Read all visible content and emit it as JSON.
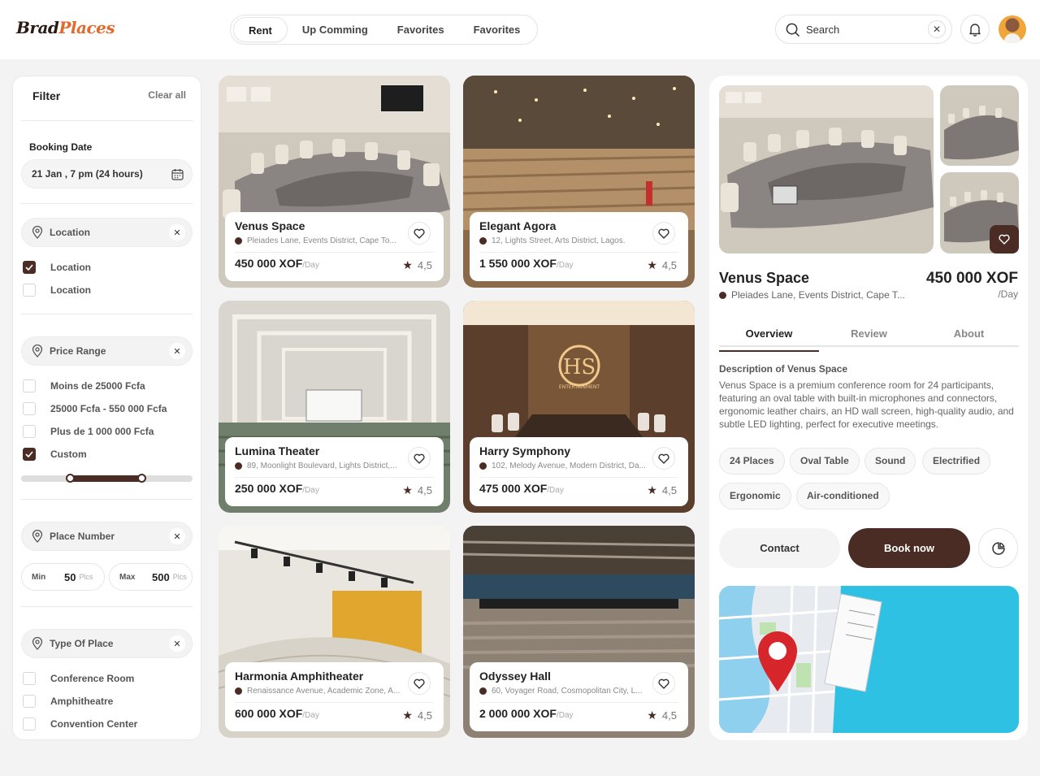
{
  "brand": {
    "part1": "Brad",
    "part2": "Places"
  },
  "nav": {
    "tabs": [
      "Rent",
      "Up Comming",
      "Favorites",
      "Favorites"
    ]
  },
  "search": {
    "placeholder": "Search"
  },
  "filter": {
    "title": "Filter",
    "clear": "Clear all",
    "booking_label": "Booking Date",
    "booking_value": "21 Jan , 7 pm  (24 hours)",
    "location": {
      "label": "Location",
      "options": [
        {
          "label": "Location",
          "checked": true
        },
        {
          "label": "Location",
          "checked": false
        }
      ]
    },
    "price": {
      "label": "Price Range",
      "options": [
        {
          "label": "Moins de 25000 Fcfa",
          "checked": false
        },
        {
          "label": "25000 Fcfa - 550 000 Fcfa",
          "checked": false
        },
        {
          "label": "Plus de 1 000 000 Fcfa",
          "checked": false
        },
        {
          "label": "Custom",
          "checked": true
        }
      ]
    },
    "place_number": {
      "label": "Place Number",
      "min_label": "Min",
      "min_value": "50",
      "max_label": "Max",
      "max_value": "500",
      "unit": "Plcs"
    },
    "type": {
      "label": "Type Of Place",
      "options": [
        {
          "label": "Conference Room",
          "checked": false
        },
        {
          "label": "Amphitheatre",
          "checked": false
        },
        {
          "label": "Convention Center",
          "checked": false
        }
      ]
    }
  },
  "cards": [
    {
      "name": "Venus Space",
      "address": "Pleiades Lane, Events District, Cape To...",
      "price": "450 000 XOF",
      "per": "/Day",
      "rating": "4,5"
    },
    {
      "name": "Elegant Agora",
      "address": "12, Lights Street, Arts District, Lagos.",
      "price": "1 550 000 XOF",
      "per": "/Day",
      "rating": "4,5"
    },
    {
      "name": "Lumina Theater",
      "address": "89, Moonlight Boulevard, Lights District,...",
      "price": "250 000 XOF",
      "per": "/Day",
      "rating": "4,5"
    },
    {
      "name": "Harry Symphony",
      "address": "102, Melody Avenue, Modern District, Da...",
      "price": "475 000 XOF",
      "per": "/Day",
      "rating": "4,5"
    },
    {
      "name": "Harmonia Amphitheater",
      "address": "Renaissance Avenue, Academic Zone, A...",
      "price": "600 000 XOF",
      "per": "/Day",
      "rating": "4,5"
    },
    {
      "name": "Odyssey Hall",
      "address": "60, Voyager Road, Cosmopolitan City, L...",
      "price": "2 000 000 XOF",
      "per": "/Day",
      "rating": "4,5"
    }
  ],
  "detail": {
    "name": "Venus Space",
    "address": "Pleiades Lane, Events District, Cape T...",
    "price": "450 000 XOF",
    "per": "/Day",
    "tabs": [
      "Overview",
      "Review",
      "About"
    ],
    "desc_title": "Description of Venus Space",
    "description": "Venus Space is a premium conference room for 24 participants, featuring an oval table with built-in microphones and connectors, ergonomic leather chairs, an HD wall screen, high-quality audio, and subtle LED lighting, perfect for executive meetings.",
    "tags": [
      "24 Places",
      "Oval Table",
      "Sound",
      "Electrified",
      "Ergonomic",
      "Air-conditioned"
    ],
    "contact": "Contact",
    "book": "Book now",
    "hs_logo": "HS",
    "hs_sub": "ENTERTAINMENT"
  },
  "colors": {
    "accent": "#4a2c24",
    "brand_orange": "#e26a2c"
  }
}
